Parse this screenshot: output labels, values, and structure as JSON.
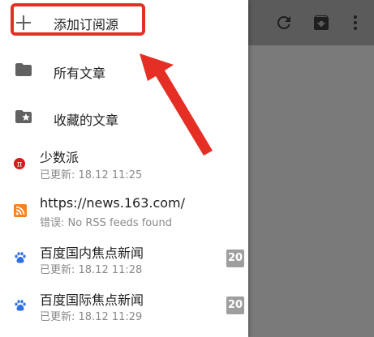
{
  "drawer": {
    "add_feed": {
      "icon": "plus-icon",
      "label": "添加订阅源"
    },
    "all_articles": {
      "icon": "folder-icon",
      "label": "所有文章"
    },
    "starred_articles": {
      "icon": "folder-star-icon",
      "label": "收藏的文章"
    },
    "feeds": [
      {
        "icon": "sspai-icon",
        "title": "少数派",
        "subtitle": "已更新: 18.12 11:25",
        "count": ""
      },
      {
        "icon": "rss-icon",
        "title": "https://news.163.com/",
        "subtitle": "错误: No RSS feeds found",
        "count": ""
      },
      {
        "icon": "baidu-paw-icon",
        "title": "百度国内焦点新闻",
        "subtitle": "已更新: 18.12 11:28",
        "count": "20"
      },
      {
        "icon": "baidu-paw-icon",
        "title": "百度国际焦点新闻",
        "subtitle": "已更新: 18.12 11:29",
        "count": "20"
      }
    ]
  },
  "toolbar": {
    "icons": [
      "refresh-icon",
      "archive-icon",
      "more-vert-icon"
    ]
  },
  "colors": {
    "highlight": "#e62f24",
    "toolbar": "#5b5b5b",
    "scrim": "#7a7a7a",
    "badge": "#9e9e9e",
    "rss": "#f5821f",
    "baidu": "#2f6fe0",
    "sspai": "#d7191c"
  }
}
